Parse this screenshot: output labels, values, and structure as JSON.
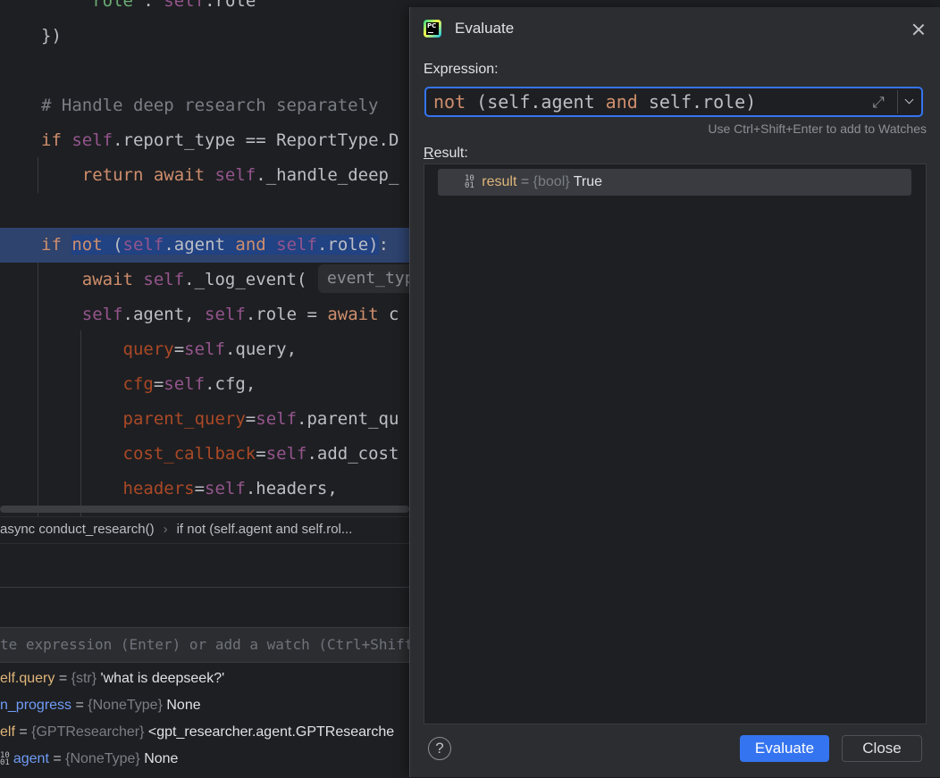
{
  "editor": {
    "lines": [
      {
        "parts": [
          {
            "t": "    "
          },
          {
            "t": "\"role\"",
            "c": "str"
          },
          {
            "t": ": "
          },
          {
            "t": "self",
            "c": "slf"
          },
          {
            "t": ".role"
          }
        ]
      },
      {
        "parts": [
          {
            "t": "})"
          }
        ]
      },
      {
        "parts": []
      },
      {
        "parts": [
          {
            "t": "# Handle deep research separately",
            "c": "cmt"
          }
        ]
      },
      {
        "parts": [
          {
            "t": "if ",
            "c": "kw"
          },
          {
            "t": "self",
            "c": "slf"
          },
          {
            "t": ".report_type == ReportType.D"
          }
        ]
      },
      {
        "parts": [
          {
            "t": "    "
          },
          {
            "t": "return await ",
            "c": "kw"
          },
          {
            "t": "self",
            "c": "slf"
          },
          {
            "t": "._handle_deep_"
          }
        ]
      },
      {
        "parts": []
      },
      {
        "parts": [
          {
            "t": "if ",
            "c": "kw"
          },
          {
            "t": "not",
            "c": "kw",
            "s": 1
          },
          {
            "t": " (",
            "s": 1
          },
          {
            "t": "self",
            "c": "slf",
            "s": 1
          },
          {
            "t": ".agent ",
            "s": 1
          },
          {
            "t": "and",
            "c": "kw",
            "s": 1
          },
          {
            "t": " ",
            "s": 1
          },
          {
            "t": "self",
            "c": "slf",
            "s": 1
          },
          {
            "t": ".role)",
            "s": 1
          },
          {
            "t": ":"
          }
        ],
        "highlight": true
      },
      {
        "parts": [
          {
            "t": "    "
          },
          {
            "t": "await ",
            "c": "kw"
          },
          {
            "t": "self",
            "c": "slf"
          },
          {
            "t": "._log_event("
          }
        ]
      },
      {
        "parts": [
          {
            "t": "    "
          },
          {
            "t": "self",
            "c": "slf"
          },
          {
            "t": ".agent, "
          },
          {
            "t": "self",
            "c": "slf"
          },
          {
            "t": ".role = "
          },
          {
            "t": "await ",
            "c": "kw"
          },
          {
            "t": "c"
          }
        ]
      },
      {
        "parts": [
          {
            "t": "        "
          },
          {
            "t": "query",
            "c": "prm"
          },
          {
            "t": "="
          },
          {
            "t": "self",
            "c": "slf"
          },
          {
            "t": ".query,"
          }
        ]
      },
      {
        "parts": [
          {
            "t": "        "
          },
          {
            "t": "cfg",
            "c": "prm"
          },
          {
            "t": "="
          },
          {
            "t": "self",
            "c": "slf"
          },
          {
            "t": ".cfg,"
          }
        ]
      },
      {
        "parts": [
          {
            "t": "        "
          },
          {
            "t": "parent_query",
            "c": "prm"
          },
          {
            "t": "="
          },
          {
            "t": "self",
            "c": "slf"
          },
          {
            "t": ".parent_qu"
          }
        ]
      },
      {
        "parts": [
          {
            "t": "        "
          },
          {
            "t": "cost_callback",
            "c": "prm"
          },
          {
            "t": "="
          },
          {
            "t": "self",
            "c": "slf"
          },
          {
            "t": ".add_cost"
          }
        ]
      },
      {
        "parts": [
          {
            "t": "        "
          },
          {
            "t": "headers",
            "c": "prm"
          },
          {
            "t": "="
          },
          {
            "t": "self",
            "c": "slf"
          },
          {
            "t": ".headers,"
          }
        ]
      }
    ],
    "inlay_hint": "event_type"
  },
  "breadcrumb": {
    "item1": "async conduct_research()",
    "item2": "if not (self.agent and self.rol..."
  },
  "debugger": {
    "watch_placeholder": "te expression (Enter) or add a watch (Ctrl+Shift",
    "variables": [
      {
        "name": "elf.query",
        "type": "{str}",
        "value": "'what is deepseek?'",
        "color": "orange"
      },
      {
        "name": "n_progress",
        "type": "{NoneType}",
        "value": "None",
        "color": "blue"
      },
      {
        "name": "elf",
        "type": "{GPTResearcher}",
        "value": "<gpt_researcher.agent.GPTResearche",
        "color": "orange"
      },
      {
        "name": "agent",
        "type": "{NoneType}",
        "value": "None",
        "color": "blue",
        "icon": "binary-icon"
      }
    ]
  },
  "dialog": {
    "title": "Evaluate",
    "expression_label": "Expression:",
    "expression_parts": [
      {
        "t": "not",
        "c": "kw"
      },
      {
        "t": " (self.agent "
      },
      {
        "t": "and",
        "c": "kw"
      },
      {
        "t": " self.role)"
      }
    ],
    "watch_hint": "Use Ctrl+Shift+Enter to add to Watches",
    "result_label": "Result:",
    "result": {
      "name": "result",
      "eq": " = ",
      "type": "{bool}",
      "value": "True"
    },
    "buttons": {
      "help": "?",
      "evaluate": "Evaluate",
      "close": "Close"
    }
  },
  "colors": {
    "accent": "#3574f0",
    "keyword": "#cf8e6d",
    "self": "#94558d",
    "param": "#aa4926",
    "string": "#6aab73"
  }
}
